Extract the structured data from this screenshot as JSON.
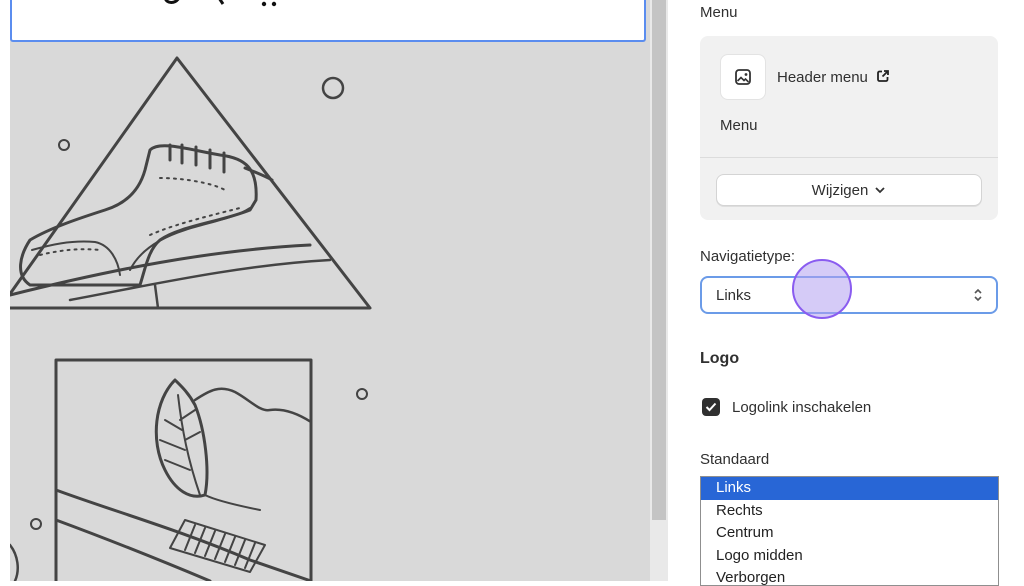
{
  "menu_section": {
    "title": "Menu",
    "card": {
      "menu_name": "Header menu",
      "subtitle": "Menu",
      "change_button": "Wijzigen"
    }
  },
  "navigation": {
    "label": "Navigatietype:",
    "selected": "Links"
  },
  "logo_section": {
    "heading": "Logo",
    "checkbox_label": "Logolink inschakelen",
    "checkbox_checked": true
  },
  "standaard": {
    "label": "Standaard",
    "options": [
      "Links",
      "Rechts",
      "Centrum",
      "Logo midden",
      "Verborgen"
    ],
    "selected": "Links"
  },
  "colors": {
    "accent_focus": "#5b8def",
    "selected_option": "#2866d6",
    "cursor_highlight": "#8a5cf0",
    "preview_bg": "#d9d9d9"
  },
  "icons": [
    "external-link-icon",
    "menu-image-icon",
    "chevron-down-icon",
    "select-chevron-icon",
    "checkmark-icon"
  ]
}
